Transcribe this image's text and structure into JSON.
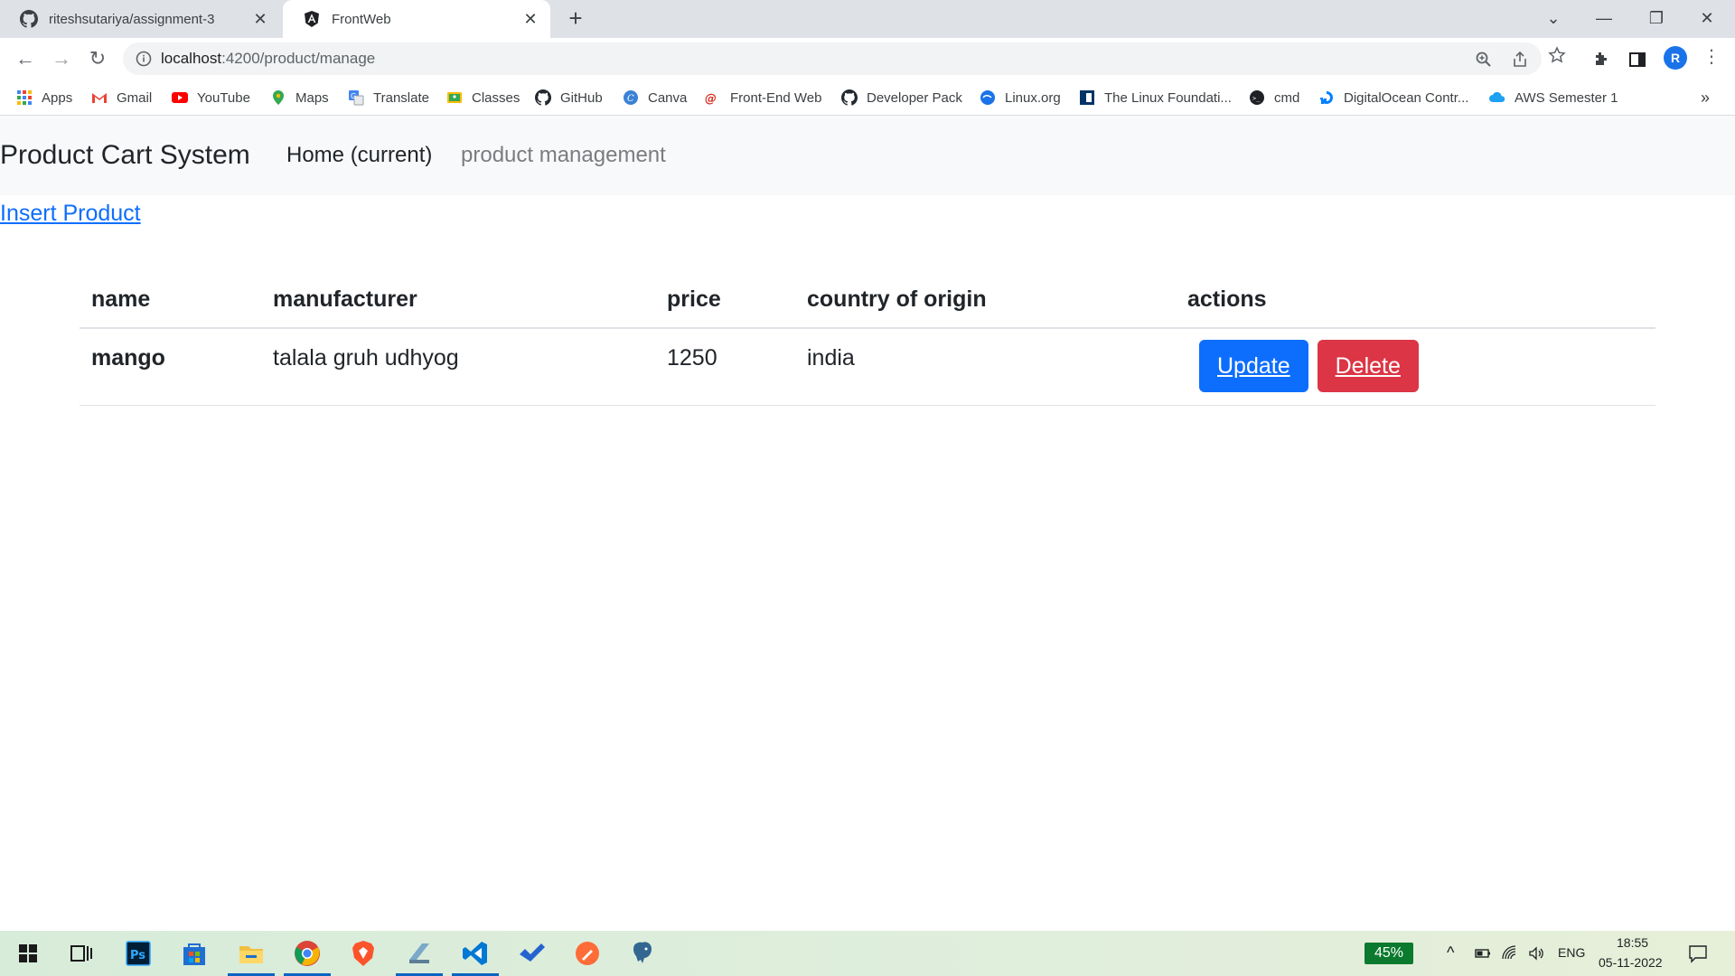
{
  "browser": {
    "tabs": [
      {
        "title": "riteshsutariya/assignment-3",
        "icon": "github-icon"
      },
      {
        "title": "FrontWeb",
        "icon": "angular-icon"
      }
    ],
    "url_host": "localhost",
    "url_path": ":4200/product/manage",
    "profile_initial": "R",
    "bookmarks": [
      {
        "label": "Apps",
        "icon": "apps-grid-icon"
      },
      {
        "label": "Gmail",
        "icon": "gmail-icon"
      },
      {
        "label": "YouTube",
        "icon": "youtube-icon"
      },
      {
        "label": "Maps",
        "icon": "maps-icon"
      },
      {
        "label": "Translate",
        "icon": "translate-icon"
      },
      {
        "label": "Classes",
        "icon": "classroom-icon"
      },
      {
        "label": "GitHub",
        "icon": "github-icon"
      },
      {
        "label": "Canva",
        "icon": "canva-icon"
      },
      {
        "label": "Front-End Web",
        "icon": "frontend-icon"
      },
      {
        "label": "Developer Pack",
        "icon": "github-icon"
      },
      {
        "label": "Linux.org",
        "icon": "linux-org-icon"
      },
      {
        "label": "The Linux Foundati...",
        "icon": "linux-foundation-icon"
      },
      {
        "label": "cmd",
        "icon": "cmd-icon"
      },
      {
        "label": "DigitalOcean Contr...",
        "icon": "digitalocean-icon"
      },
      {
        "label": "AWS Semester 1",
        "icon": "aws-icon"
      }
    ]
  },
  "app": {
    "brand": "Product Cart System",
    "nav_home": "Home (current)",
    "nav_manage": "product management",
    "insert_link": "Insert Product",
    "table": {
      "headers": [
        "name",
        "manufacturer",
        "price",
        "country of origin",
        "actions"
      ],
      "rows": [
        {
          "name": "mango",
          "manufacturer": "talala gruh udhyog",
          "price": "1250",
          "country": "india"
        }
      ],
      "update_label": "Update",
      "delete_label": "Delete"
    },
    "colors": {
      "primary": "#0d6efd",
      "danger": "#dc3545",
      "navbar_bg": "#f8f9fa"
    }
  },
  "taskbar": {
    "battery": "45%",
    "language": "ENG",
    "time": "18:55",
    "date": "05-11-2022",
    "apps": [
      "windows-start-icon",
      "task-view-icon",
      "photoshop-icon",
      "store-icon",
      "file-explorer-icon",
      "chrome-icon",
      "brave-icon",
      "tablet-app-icon",
      "vscode-icon",
      "todo-icon",
      "postman-icon",
      "postgres-icon"
    ]
  }
}
